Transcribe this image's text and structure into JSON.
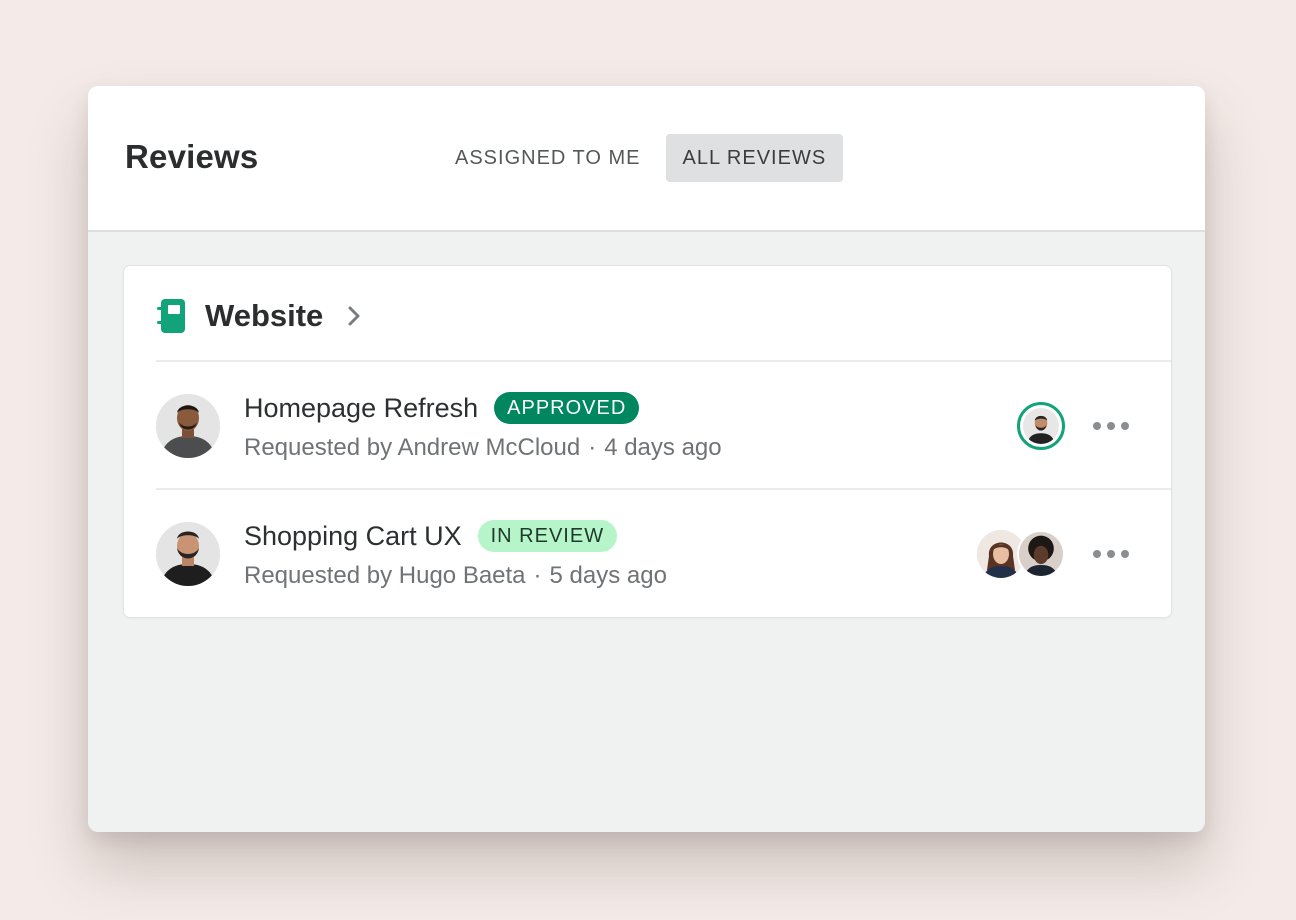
{
  "header": {
    "title": "Reviews",
    "tabs": [
      {
        "label": "ASSIGNED TO ME",
        "active": false
      },
      {
        "label": "ALL REVIEWS",
        "active": true
      }
    ]
  },
  "project": {
    "name": "Website",
    "icon": "notebook-icon",
    "icon_color": "#13a37a"
  },
  "reviews": [
    {
      "title": "Homepage Refresh",
      "status": "APPROVED",
      "status_bg": "#00875f",
      "status_fg": "#ffffff",
      "requested_by": "Requested by Andrew McCloud",
      "separator": "·",
      "time": "4 days ago",
      "reviewers": [
        "reviewer-avatar-approved"
      ]
    },
    {
      "title": "Shopping Cart UX",
      "status": "IN REVIEW",
      "status_bg": "#b6f5c9",
      "status_fg": "#1f3a2b",
      "requested_by": "Requested by Hugo Baeta",
      "separator": "·",
      "time": "5 days ago",
      "reviewers": [
        "reviewer-avatar",
        "reviewer-avatar"
      ]
    }
  ],
  "colors": {
    "background": "#f4ebe8",
    "approved_ring": "#13a37a"
  }
}
